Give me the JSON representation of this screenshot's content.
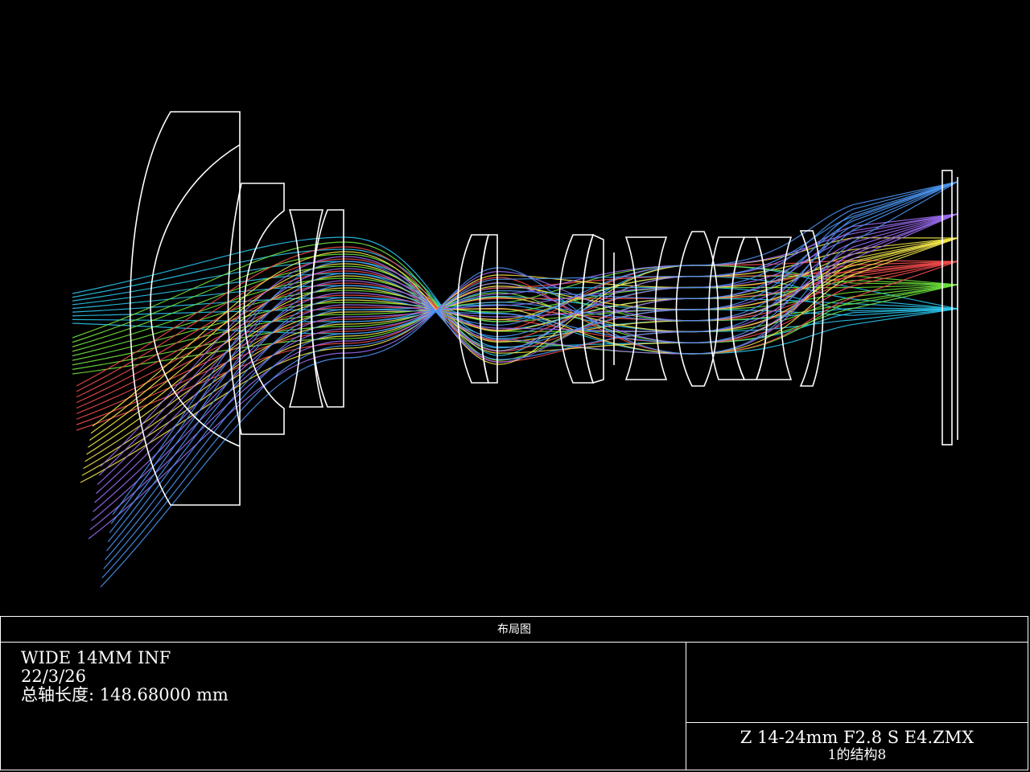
{
  "diagram": {
    "type": "optical-layout",
    "background": "#000000",
    "element_color": "#ffffff",
    "field_colors": [
      {
        "name": "field-1",
        "color": "#29c4ec"
      },
      {
        "name": "field-2",
        "color": "#6ee23c"
      },
      {
        "name": "field-3",
        "color": "#f04a4a"
      },
      {
        "name": "field-4",
        "color": "#f2e64a"
      },
      {
        "name": "field-5",
        "color": "#9a6af0"
      },
      {
        "name": "field-6",
        "color": "#4a94f0"
      }
    ],
    "lens_element_count": 16
  },
  "title_block": {
    "header": "布局图",
    "line1": "WIDE 14MM INF",
    "line2": "22/3/26",
    "line3": "总轴长度:  148.68000 mm",
    "file_name": "Z 14-24mm F2.8 S E4.ZMX",
    "configuration": "1的结构8"
  }
}
